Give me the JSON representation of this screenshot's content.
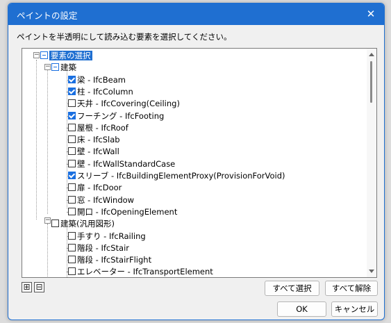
{
  "dialog": {
    "title": "ペイントの設定",
    "instruction": "ペイントを半透明にして読み込む要素を選択してください。"
  },
  "tree": [
    {
      "label": "要素の選択",
      "state": "partial",
      "selected": true
    },
    {
      "label": "建築",
      "state": "partial"
    },
    {
      "label": "梁 - IfcBeam",
      "state": "checked"
    },
    {
      "label": "柱 - IfcColumn",
      "state": "checked"
    },
    {
      "label": "天井 - IfcCovering(Ceiling)",
      "state": "unchecked"
    },
    {
      "label": "フーチング - IfcFooting",
      "state": "checked"
    },
    {
      "label": "屋根 - IfcRoof",
      "state": "unchecked"
    },
    {
      "label": "床 - IfcSlab",
      "state": "unchecked"
    },
    {
      "label": "壁 - IfcWall",
      "state": "unchecked"
    },
    {
      "label": "壁 - IfcWallStandardCase",
      "state": "unchecked"
    },
    {
      "label": "スリーブ - IfcBuildingElementProxy(ProvisionForVoid)",
      "state": "checked"
    },
    {
      "label": "扉 - IfcDoor",
      "state": "unchecked"
    },
    {
      "label": "窓 - IfcWindow",
      "state": "unchecked"
    },
    {
      "label": "開口 - IfcOpeningElement",
      "state": "unchecked"
    },
    {
      "label": "建築(汎用図形)",
      "state": "unchecked"
    },
    {
      "label": "手すり - IfcRailing",
      "state": "unchecked"
    },
    {
      "label": "階段 - IfcStair",
      "state": "unchecked"
    },
    {
      "label": "階段 - IfcStairFlight",
      "state": "unchecked"
    },
    {
      "label": "エレベーター - IfcTransportElement",
      "state": "unchecked"
    }
  ],
  "buttons": {
    "expand_all": "⊞",
    "collapse_all": "⊟",
    "select_all": "すべて選択",
    "deselect_all": "すべて解除",
    "ok": "OK",
    "cancel": "キャンセル"
  },
  "icons": {
    "close": "✕"
  }
}
